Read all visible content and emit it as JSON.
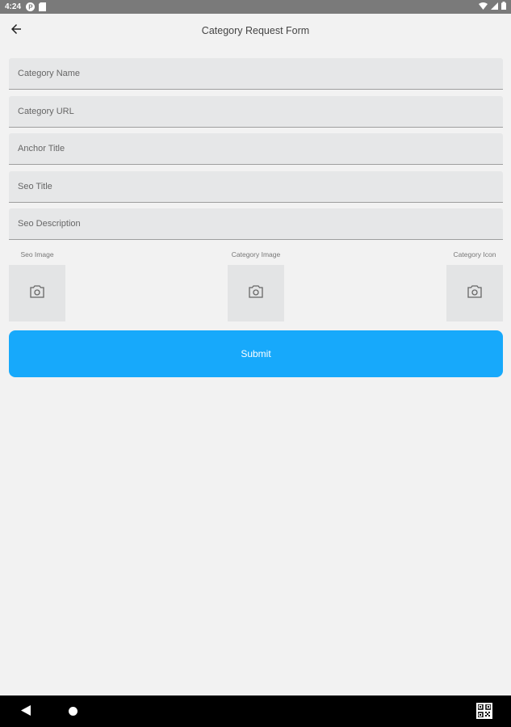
{
  "status_bar": {
    "time": "4:24",
    "left_icons": [
      "p-circle-icon",
      "sd-card-icon"
    ],
    "right_icons": [
      "wifi-icon",
      "signal-icon",
      "battery-icon"
    ]
  },
  "app_bar": {
    "back_icon": "arrow-left-icon",
    "title": "Category Request Form"
  },
  "form": {
    "fields": [
      {
        "placeholder": "Category Name",
        "value": ""
      },
      {
        "placeholder": "Category URL",
        "value": ""
      },
      {
        "placeholder": "Anchor Title",
        "value": ""
      },
      {
        "placeholder": "Seo Title",
        "value": ""
      },
      {
        "placeholder": "Seo Description",
        "value": ""
      }
    ],
    "images": [
      {
        "label": "Seo Image",
        "icon": "camera-icon"
      },
      {
        "label": "Category Image",
        "icon": "camera-icon"
      },
      {
        "label": "Category Icon",
        "icon": "camera-icon"
      }
    ],
    "submit_label": "Submit"
  },
  "colors": {
    "accent": "#17a9fb",
    "background": "#f2f2f2",
    "field_background": "#e6e7e8",
    "status_bar": "#7a7a7a",
    "nav_bar": "#000000"
  },
  "nav_bar": {
    "icons": [
      "nav-back-icon",
      "nav-home-icon",
      "qr-code-icon"
    ]
  }
}
